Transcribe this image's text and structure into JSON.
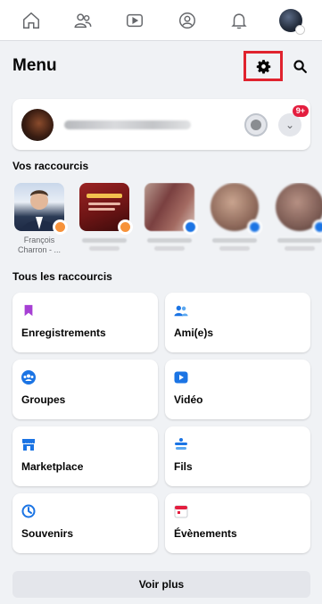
{
  "nav": {
    "icons": [
      "home-icon",
      "friends-icon",
      "watch-icon",
      "profile-icon",
      "notifications-icon",
      "account-avatar"
    ]
  },
  "header": {
    "title": "Menu",
    "settings_icon": "gear-icon",
    "search_icon": "search-icon",
    "highlight_color": "#e0232e"
  },
  "profile": {
    "badge": "9+"
  },
  "shortcuts": {
    "title": "Vos raccourcis",
    "items": [
      {
        "label": "François Charron - ...",
        "color": "#e4e6eb",
        "badge_color": "#f7923a"
      },
      {
        "label": "",
        "color": "#7a1c1c",
        "badge_color": "#f7923a"
      },
      {
        "label": "",
        "color": "#8d5b5b",
        "badge_color": "#1b74e4"
      },
      {
        "label": "",
        "color": "#a08474",
        "badge_color": "#1b74e4"
      },
      {
        "label": "",
        "color": "#8c6f66",
        "badge_color": "#1b74e4"
      }
    ]
  },
  "all_shortcuts": {
    "title": "Tous les raccourcis",
    "tiles": [
      {
        "label": "Enregistrements",
        "icon": "bookmark-icon",
        "color": "#a640d4"
      },
      {
        "label": "Ami(e)s",
        "icon": "friends-icon",
        "color": "#1b74e4"
      },
      {
        "label": "Groupes",
        "icon": "groups-icon",
        "color": "#1b74e4"
      },
      {
        "label": "Vidéo",
        "icon": "video-icon",
        "color": "#1b74e4"
      },
      {
        "label": "Marketplace",
        "icon": "store-icon",
        "color": "#1b74e4"
      },
      {
        "label": "Fils",
        "icon": "feeds-icon",
        "color": "#1b74e4"
      },
      {
        "label": "Souvenirs",
        "icon": "memories-icon",
        "color": "#1b74e4"
      },
      {
        "label": "Évènements",
        "icon": "calendar-icon",
        "color": "#e41e3f"
      }
    ]
  },
  "footer": {
    "more_label": "Voir plus"
  }
}
